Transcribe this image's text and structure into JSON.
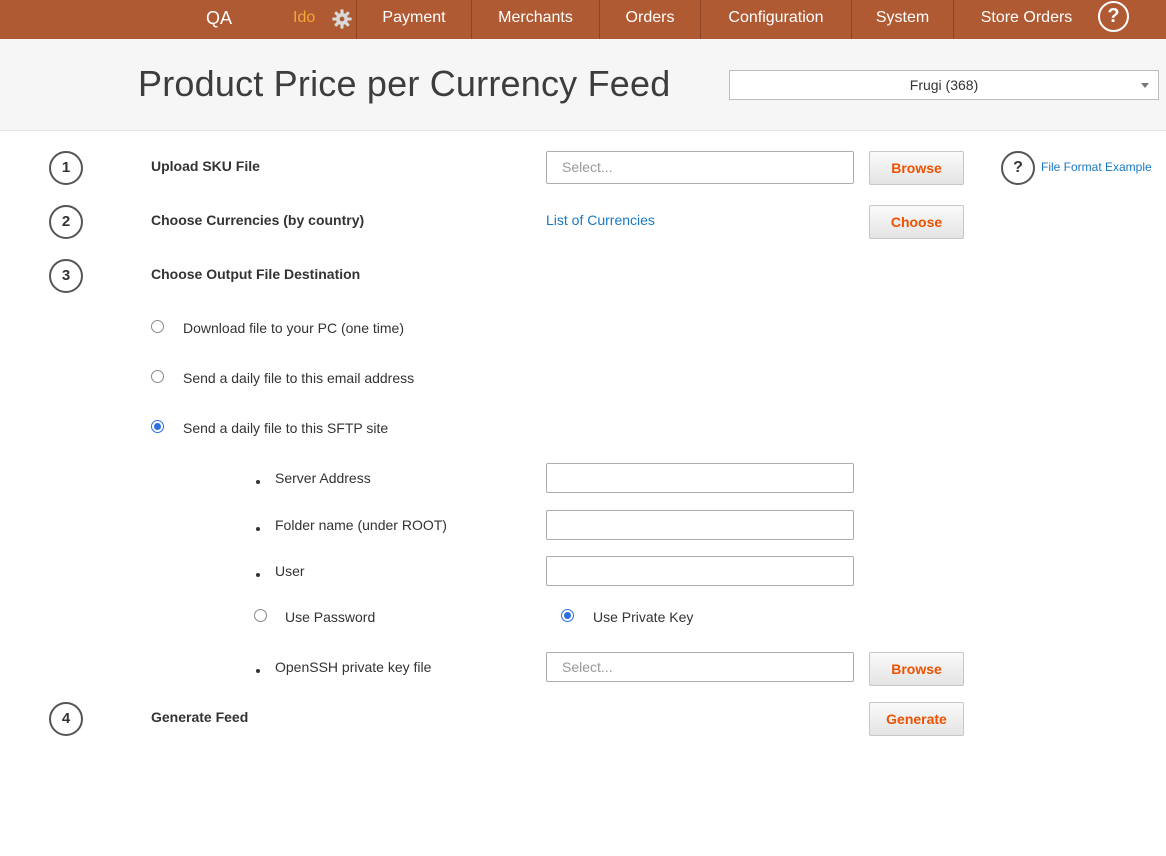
{
  "nav": {
    "environment": "QA",
    "user": "Ido",
    "items": [
      "Payment",
      "Merchants",
      "Orders",
      "Configuration",
      "System",
      "Store Orders"
    ],
    "help_glyph": "?"
  },
  "header": {
    "title": "Product Price per Currency Feed",
    "merchant_selected": "Frugi (368)"
  },
  "steps": [
    {
      "number": "1",
      "label": "Upload SKU File"
    },
    {
      "number": "2",
      "label": "Choose Currencies (by country)"
    },
    {
      "number": "3",
      "label": "Choose Output File Destination"
    },
    {
      "number": "4",
      "label": "Generate Feed"
    }
  ],
  "upload": {
    "placeholder": "Select...",
    "browse_label": "Browse",
    "help_glyph": "?",
    "format_link": "File Format Example"
  },
  "currencies": {
    "link": "List of Currencies",
    "choose_label": "Choose"
  },
  "destination": {
    "options": [
      "Download file to your PC (one time)",
      "Send a daily file to this email address",
      "Send a daily file to this SFTP site"
    ],
    "selected_index": 2
  },
  "sftp": {
    "server_label": "Server Address",
    "folder_label": "Folder name (under ROOT)",
    "user_label": "User",
    "password_option": "Use Password",
    "key_option": "Use Private Key",
    "auth_selected": "key",
    "keyfile_label": "OpenSSH private key file",
    "keyfile_placeholder": "Select...",
    "browse_label": "Browse"
  },
  "generate": {
    "button_label": "Generate"
  },
  "icons": {
    "settings": "gear-icon",
    "help": "help-icon",
    "dropdown": "chevron-down-icon"
  },
  "colors": {
    "nav_bg": "#b05a33",
    "user_accent": "#f7a534",
    "button_text": "#eb5202",
    "link": "#1979c3",
    "radio_checked": "#2b6fe0"
  }
}
